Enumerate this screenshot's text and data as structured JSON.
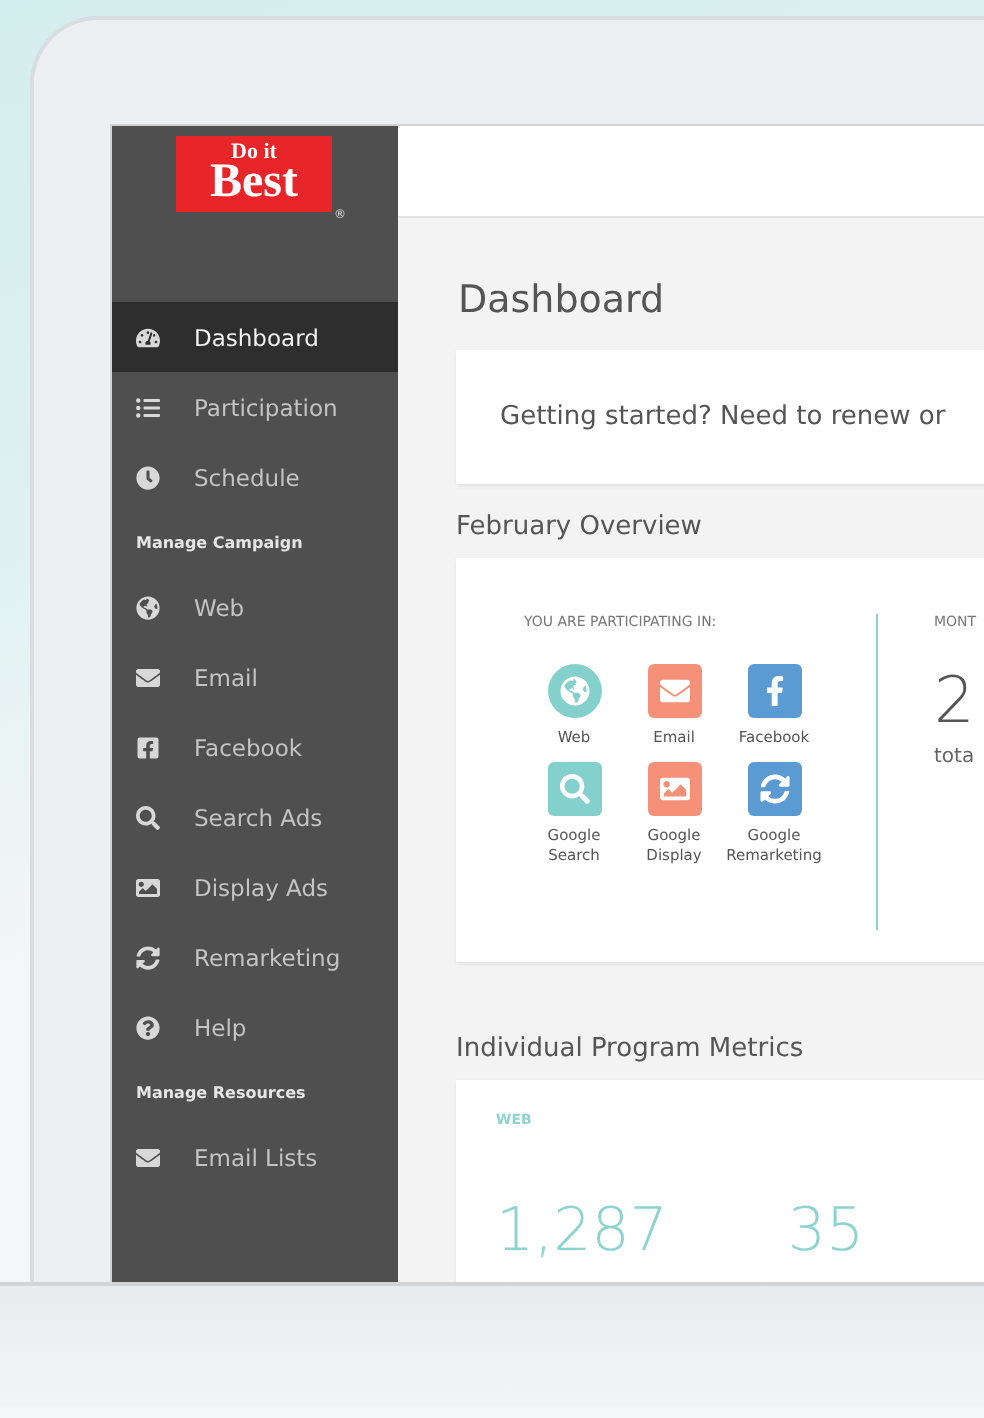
{
  "logo": {
    "top": "Do it",
    "bottom": "Best",
    "mark": "®"
  },
  "sidebar": {
    "items": [
      {
        "kind": "link",
        "label": "Dashboard",
        "selected": true
      },
      {
        "kind": "link",
        "label": "Participation",
        "selected": false
      },
      {
        "kind": "link",
        "label": "Schedule",
        "selected": false
      },
      {
        "kind": "section",
        "label": "Manage Campaign"
      },
      {
        "kind": "link",
        "label": "Web",
        "selected": false
      },
      {
        "kind": "link",
        "label": "Email",
        "selected": false
      },
      {
        "kind": "link",
        "label": "Facebook",
        "selected": false
      },
      {
        "kind": "link",
        "label": "Search Ads",
        "selected": false
      },
      {
        "kind": "link",
        "label": "Display Ads",
        "selected": false
      },
      {
        "kind": "link",
        "label": "Remarketing",
        "selected": false
      },
      {
        "kind": "link",
        "label": "Help",
        "selected": false
      },
      {
        "kind": "section",
        "label": "Manage Resources"
      },
      {
        "kind": "link",
        "label": "Email Lists",
        "selected": false
      }
    ]
  },
  "page_title": "Dashboard",
  "notice": "Getting started? Need to renew or",
  "overview": {
    "title": "February Overview",
    "participating_label": "YOU ARE PARTICIPATING IN:",
    "programs": [
      {
        "label": "Web",
        "color": "#84d0cc"
      },
      {
        "label": "Email",
        "color": "#f59178"
      },
      {
        "label": "Facebook",
        "color": "#5b9bd1"
      },
      {
        "label": "Google Search",
        "color": "#84d0cc"
      },
      {
        "label": "Google Display",
        "color": "#f59178"
      },
      {
        "label": "Google Remarketing",
        "color": "#5b9bd1"
      }
    ],
    "column_2": {
      "heading": "MONT",
      "value": "2",
      "caption": "tota"
    }
  },
  "metrics": {
    "title": "Individual Program Metrics",
    "card_label": "WEB",
    "values": [
      "1,287",
      "35"
    ]
  }
}
